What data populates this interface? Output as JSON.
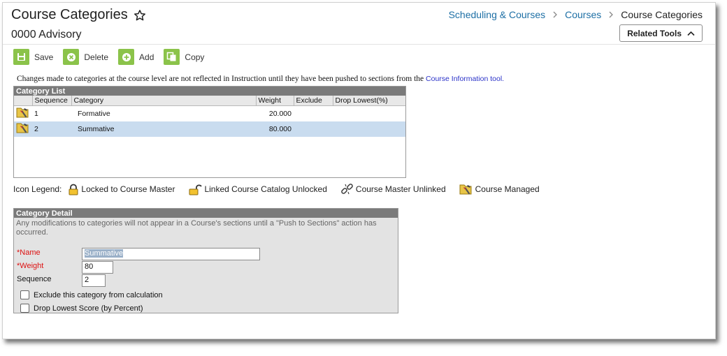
{
  "header": {
    "title": "Course Categories",
    "subtitle": "0000 Advisory",
    "breadcrumbs": [
      {
        "label": "Scheduling & Courses"
      },
      {
        "label": "Courses"
      },
      {
        "label": "Course Categories"
      }
    ],
    "related_tools_label": "Related Tools"
  },
  "toolbar": {
    "save_label": "Save",
    "delete_label": "Delete",
    "add_label": "Add",
    "copy_label": "Copy"
  },
  "notice": {
    "text": "Changes made to categories at the course level are not reflected in Instruction until they have been pushed to sections from the ",
    "link_text": "Course Information tool."
  },
  "category_list": {
    "title": "Category List",
    "columns": [
      "Sequence",
      "Category",
      "Weight",
      "Exclude",
      "Drop Lowest(%)"
    ],
    "rows": [
      {
        "sequence": "1",
        "category": "Formative",
        "weight": "20.000",
        "exclude": "",
        "drop_lowest": "",
        "icon": "course-managed-icon"
      },
      {
        "sequence": "2",
        "category": "Summative",
        "weight": "80.000",
        "exclude": "",
        "drop_lowest": "",
        "icon": "course-managed-icon"
      }
    ]
  },
  "legend": {
    "title": "Icon Legend:",
    "items": [
      {
        "label": "Locked to Course Master",
        "icon": "lock-icon"
      },
      {
        "label": "Linked Course Catalog Unlocked",
        "icon": "unlock-icon"
      },
      {
        "label": "Course Master Unlinked",
        "icon": "broken-link-icon"
      },
      {
        "label": "Course Managed",
        "icon": "course-managed-icon"
      }
    ]
  },
  "category_detail": {
    "title": "Category Detail",
    "note": "Any modifications to categories will not appear in a Course's sections until a \"Push to Sections\" action has occurred.",
    "name_label": "*Name",
    "name_value": "Summative",
    "weight_label": "*Weight",
    "weight_value": "80",
    "sequence_label": "Sequence",
    "sequence_value": "2",
    "exclude_label": "Exclude this category from calculation",
    "drop_label": "Drop Lowest Score (by Percent)"
  },
  "colors": {
    "toolbar_green": "#8bc34a",
    "link_blue": "#1d6fa5",
    "panel_header": "#7a7a7a",
    "selected_row": "#c9dcef",
    "required_red": "#dd1111"
  }
}
